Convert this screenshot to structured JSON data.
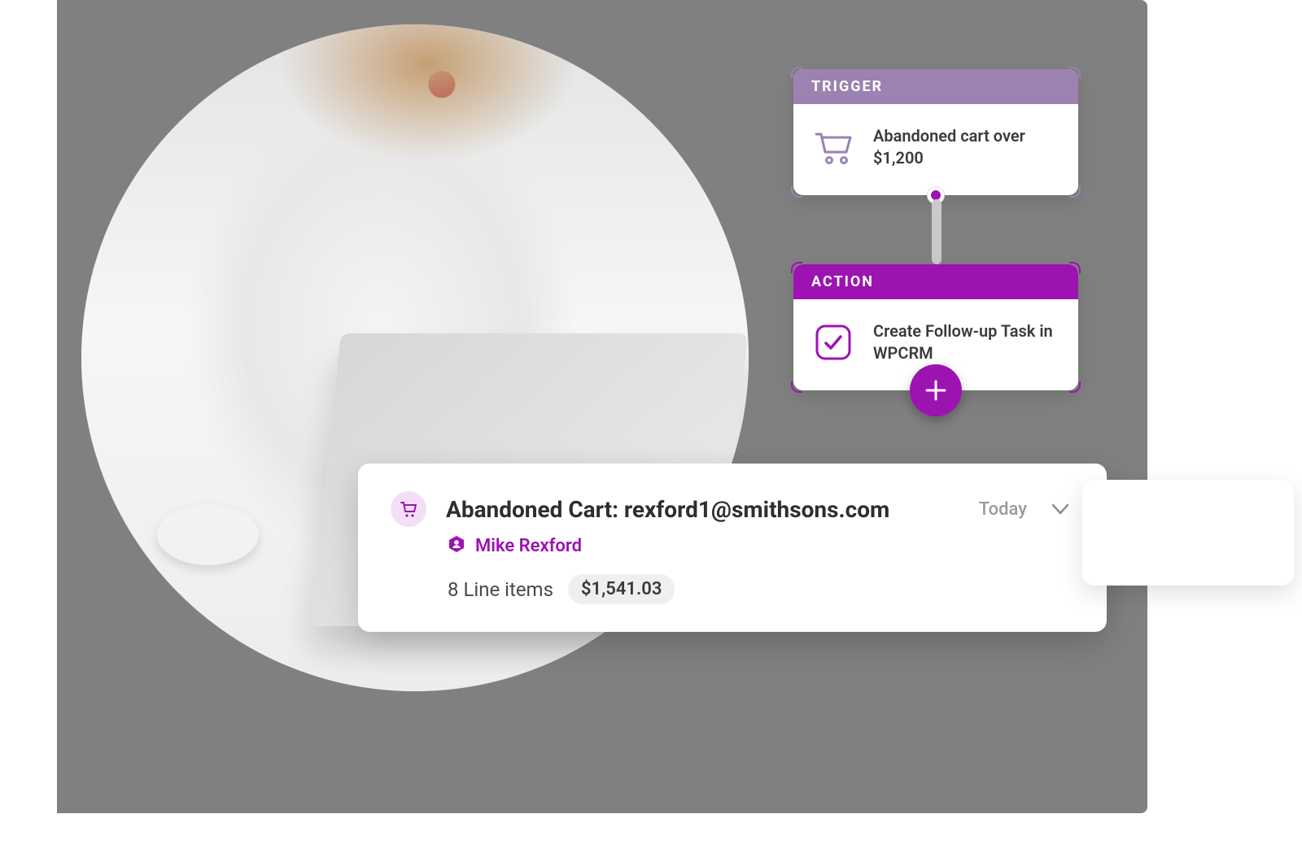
{
  "workflow": {
    "trigger": {
      "header": "TRIGGER",
      "text": "Abandoned cart over $1,200"
    },
    "action": {
      "header": "ACTION",
      "text": "Create Follow-up Task in WPCRM"
    }
  },
  "task": {
    "title": "Abandoned Cart: rexford1@smithsons.com",
    "date": "Today",
    "user": "Mike Rexford",
    "line_items_label": "8 Line items",
    "total": "$1,541.03"
  },
  "colors": {
    "brand": "#9c13b2",
    "trigger_header": "#9b82b1",
    "action_header": "#9c13b2",
    "gray_bg": "#808080"
  }
}
